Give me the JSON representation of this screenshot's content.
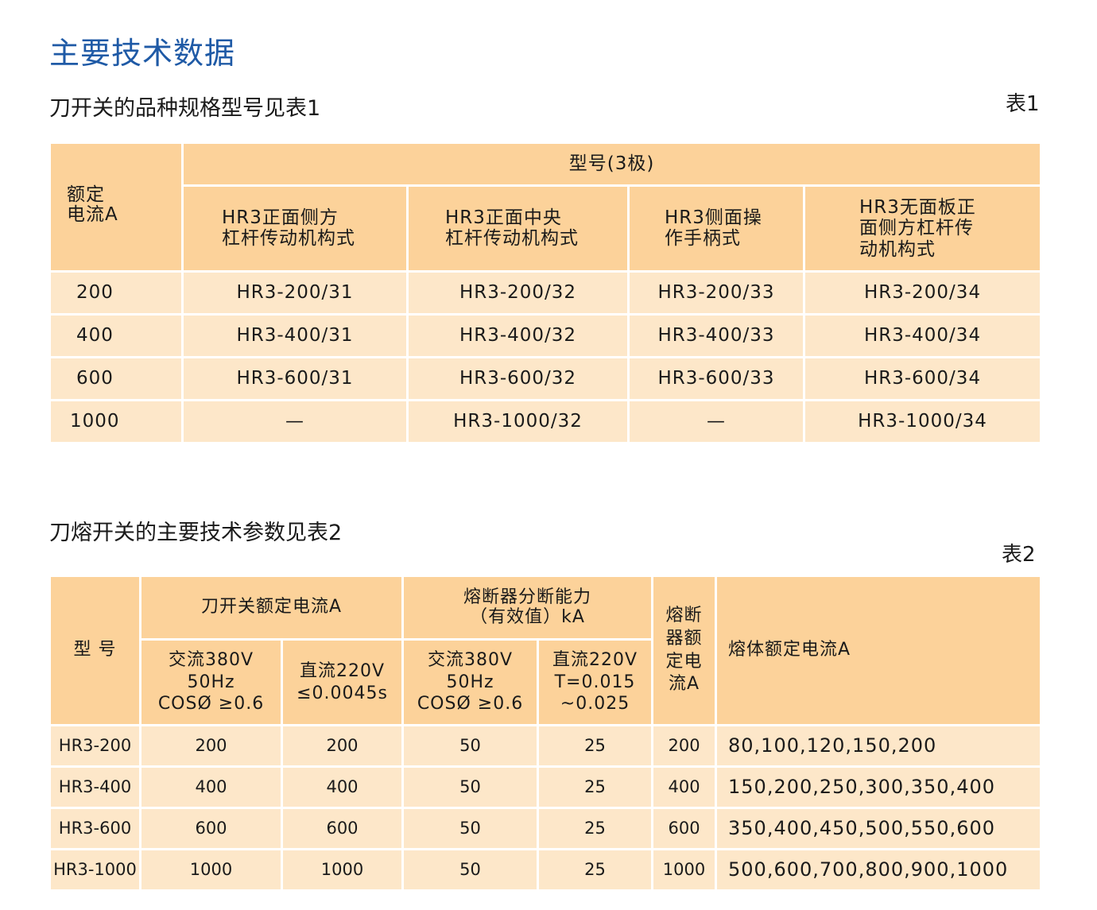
{
  "page": {
    "title": "主要技术数据"
  },
  "section1": {
    "title": "刀开关的品种规格型号见表1",
    "table_label": "表1",
    "header_current": [
      "额定",
      "电流A"
    ],
    "header_model": "型号(3极)",
    "columns": [
      [
        "HR3正面侧方",
        "杠杆传动机构式"
      ],
      [
        "HR3正面中央",
        "杠杆传动机构式"
      ],
      [
        "HR3侧面操",
        "作手柄式"
      ],
      [
        "HR3无面板正",
        "面侧方杠杆传",
        "动机构式"
      ]
    ],
    "rows": [
      {
        "current": "200",
        "models": [
          "HR3-200/31",
          "HR3-200/32",
          "HR3-200/33",
          "HR3-200/34"
        ]
      },
      {
        "current": "400",
        "models": [
          "HR3-400/31",
          "HR3-400/32",
          "HR3-400/33",
          "HR3-400/34"
        ]
      },
      {
        "current": "600",
        "models": [
          "HR3-600/31",
          "HR3-600/32",
          "HR3-600/33",
          "HR3-600/34"
        ]
      },
      {
        "current": "1000",
        "models": [
          "—",
          "HR3-1000/32",
          "—",
          "HR3-1000/34"
        ]
      }
    ]
  },
  "section2": {
    "title": "刀熔开关的主要技术参数见表2",
    "table_label": "表2",
    "header_model": "型 号",
    "header_switch_current": "刀开关额定电流A",
    "header_breaking": [
      "熔断器分断能力",
      "（有效值）kA"
    ],
    "header_fuse_current": [
      "熔断",
      "器额",
      "定电",
      "流A"
    ],
    "header_melt_current": "熔体额定电流A",
    "sub_ac_switch": [
      "交流380V",
      "50Hz",
      "COSØ ≥0.6"
    ],
    "sub_dc_switch": [
      "直流220V",
      "≤0.0045s"
    ],
    "sub_ac_break": [
      "交流380V",
      "50Hz",
      "COSØ ≥0.6"
    ],
    "sub_dc_break": [
      "直流220V",
      "T=0.015",
      "~0.025"
    ],
    "rows": [
      {
        "model": "HR3-200",
        "ac": "200",
        "dc": "200",
        "ac_break": "50",
        "dc_break": "25",
        "fuse": "200",
        "melt": "80,100,120,150,200"
      },
      {
        "model": "HR3-400",
        "ac": "400",
        "dc": "400",
        "ac_break": "50",
        "dc_break": "25",
        "fuse": "400",
        "melt": "150,200,250,300,350,400"
      },
      {
        "model": "HR3-600",
        "ac": "600",
        "dc": "600",
        "ac_break": "50",
        "dc_break": "25",
        "fuse": "600",
        "melt": "350,400,450,500,550,600"
      },
      {
        "model": "HR3-1000",
        "ac": "1000",
        "dc": "1000",
        "ac_break": "50",
        "dc_break": "25",
        "fuse": "1000",
        "melt": "500,600,700,800,900,1000"
      }
    ]
  }
}
